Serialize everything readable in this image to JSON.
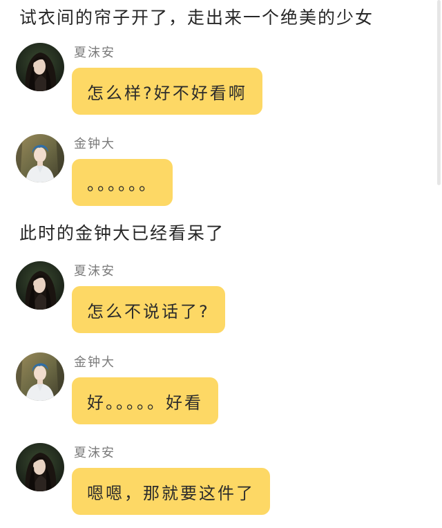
{
  "narration": [
    "试衣间的帘子开了，走出来一个绝美的少女",
    "此时的金钟大已经看呆了"
  ],
  "messages": [
    {
      "sender": "夏沫安",
      "text": "怎么样?好不好看啊",
      "avatar": "female-avatar"
    },
    {
      "sender": "金钟大",
      "text": "。。。。。。",
      "avatar": "male-avatar"
    },
    {
      "sender": "夏沫安",
      "text": "怎么不说话了?",
      "avatar": "female-avatar"
    },
    {
      "sender": "金钟大",
      "text": "好。。。。。好看",
      "avatar": "male-avatar"
    },
    {
      "sender": "夏沫安",
      "text": "嗯嗯，那就要这件了",
      "avatar": "female-avatar"
    }
  ],
  "colors": {
    "bubble": "#fdd865",
    "sender_name": "#7a7a7a",
    "background": "#ffffff"
  }
}
